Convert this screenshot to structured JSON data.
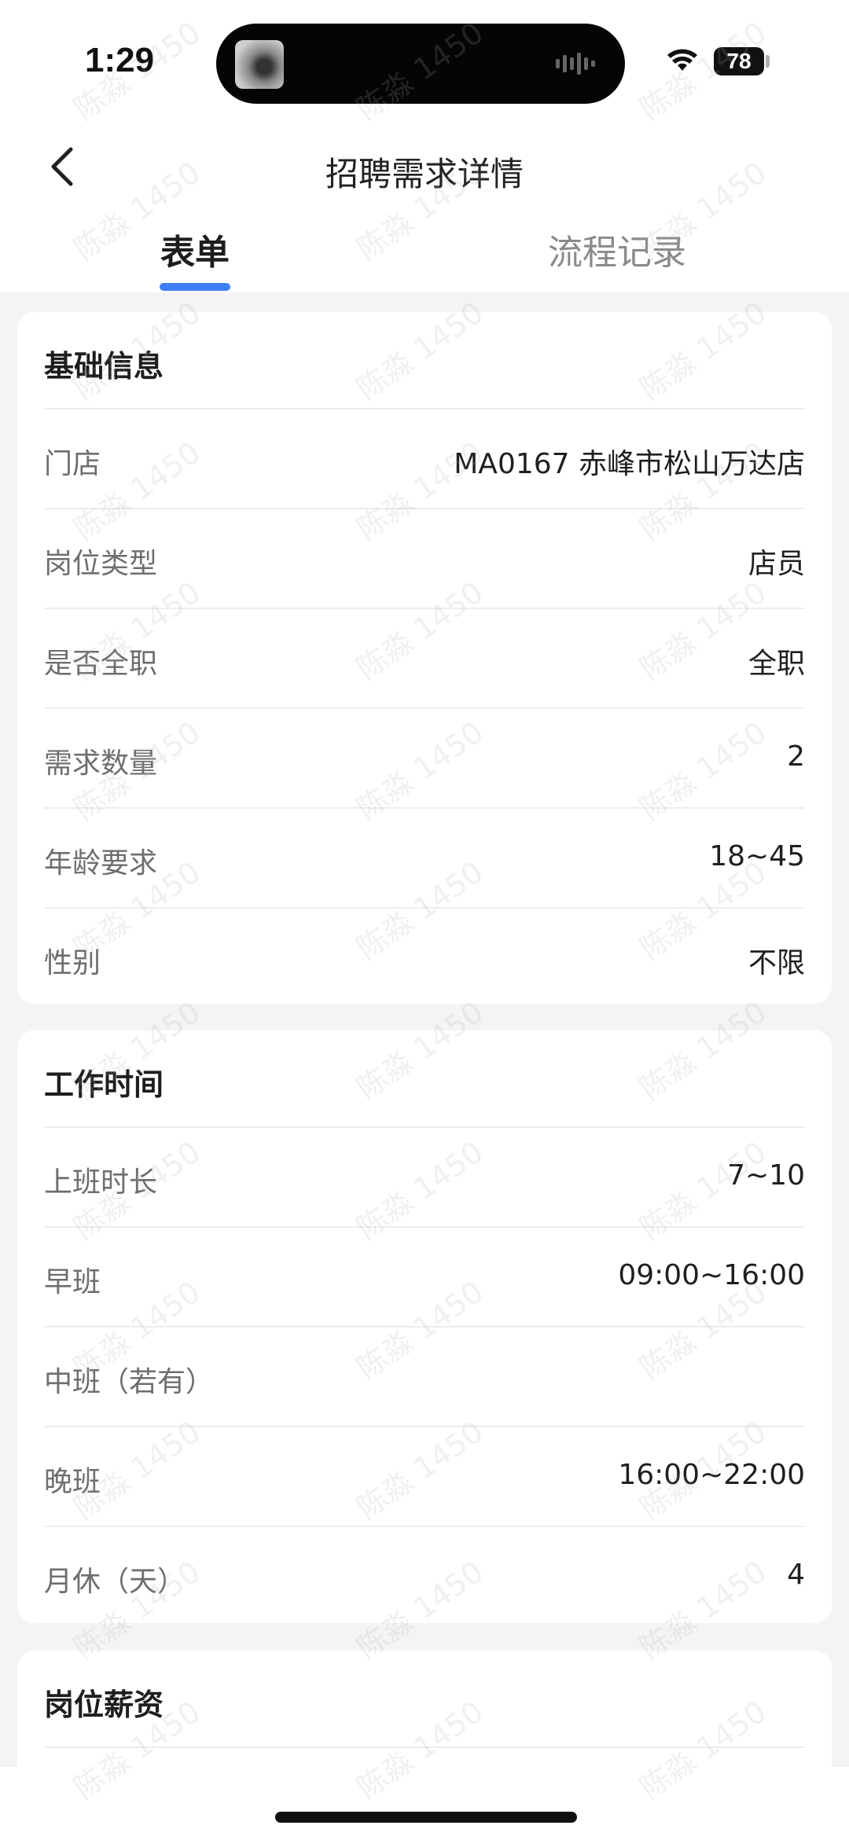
{
  "status_bar": {
    "time": "1:29",
    "battery": "78"
  },
  "nav": {
    "title": "招聘需求详情"
  },
  "tabs": [
    {
      "label": "表单"
    },
    {
      "label": "流程记录"
    }
  ],
  "sections": [
    {
      "title": "基础信息",
      "rows": [
        {
          "label": "门店",
          "value": "MA0167 赤峰市松山万达店"
        },
        {
          "label": "岗位类型",
          "value": "店员"
        },
        {
          "label": "是否全职",
          "value": "全职"
        },
        {
          "label": "需求数量",
          "value": "2"
        },
        {
          "label": "年龄要求",
          "value": "18~45"
        },
        {
          "label": "性别",
          "value": "不限"
        }
      ]
    },
    {
      "title": "工作时间",
      "rows": [
        {
          "label": "上班时长",
          "value": "7~10"
        },
        {
          "label": "早班",
          "value": "09:00~16:00"
        },
        {
          "label": "中班（若有）",
          "value": ""
        },
        {
          "label": "晚班",
          "value": "16:00~22:00"
        },
        {
          "label": "月休（天）",
          "value": "4"
        }
      ]
    },
    {
      "title": "岗位薪资",
      "rows": []
    }
  ],
  "watermark": "陈淼 1450",
  "colors": {
    "accent": "#3d7ff5",
    "background": "#f4f4f5"
  }
}
